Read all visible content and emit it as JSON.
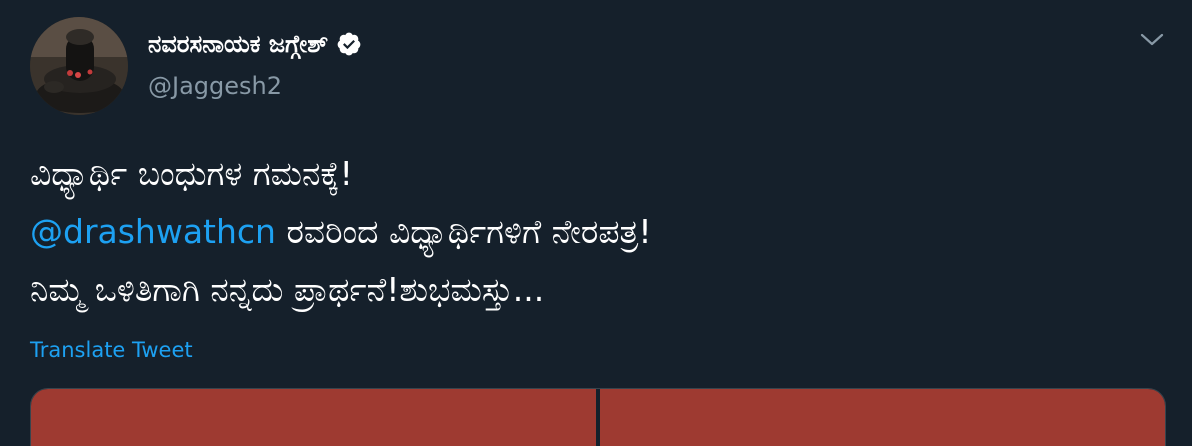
{
  "user": {
    "display_name": "ನವರಸನಾಯಕ ಜಗ್ಗೇಶ್",
    "handle": "@Jaggesh2",
    "verified_icon": "verified-badge-icon"
  },
  "menu": {
    "caret_icon": "chevron-down-icon"
  },
  "tweet": {
    "line1": "ವಿಧ್ಯಾರ್ಥಿ ಬಂಧುಗಳ ಗಮನಕ್ಕೆ!",
    "mention": "@drashwathcn",
    "line2_rest": " ರವರಿಂದ ವಿಧ್ಯಾರ್ಥಿಗಳಿಗೆ ನೇರಪತ್ರ!",
    "line3": "ನಿಮ್ಮ ಒಳಿತಿಗಾಗಿ ನನ್ನದು ಪ್ರಾರ್ಥನೆ!ಶುಭಮಸ್ತು..."
  },
  "translate_label": "Translate Tweet",
  "colors": {
    "background": "#15202b",
    "text": "#ffffff",
    "secondary": "#8899a6",
    "accent": "#1da1f2",
    "media_tile": "#9e3a31"
  }
}
